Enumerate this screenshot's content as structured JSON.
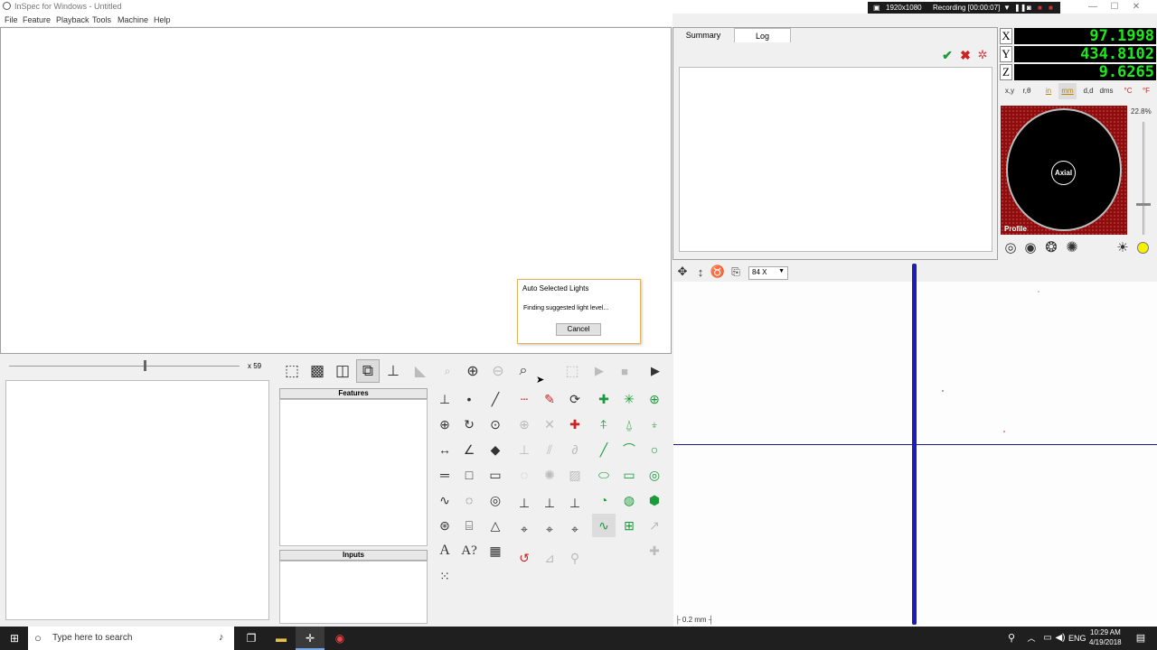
{
  "window": {
    "title": "InSpec for Windows - Untitled",
    "minimize": "—",
    "maximize": "☐",
    "close": "✕"
  },
  "recording": {
    "resolution": "1920x1080",
    "status": "Recording [00:00:07]"
  },
  "menu": [
    "File",
    "Feature",
    "Playback",
    "Tools",
    "Machine",
    "Help"
  ],
  "tabs": {
    "summary": "Summary",
    "log": "Log"
  },
  "dro": {
    "x_label": "X",
    "x_value": "97.1998",
    "y_label": "Y",
    "y_value": "434.8102",
    "z_label": "Z",
    "z_value": "9.6265",
    "mode_buttons": [
      "x,y",
      "r,θ",
      "in",
      "mm",
      "d,d",
      "dms",
      "°C",
      "°F"
    ]
  },
  "light": {
    "percent": "22.8%",
    "axial_label": "Axial",
    "profile_label": "Profile"
  },
  "slider": {
    "magnification": "x 59"
  },
  "panels": {
    "features": "Features",
    "inputs": "Inputs"
  },
  "camera": {
    "zoom": "84 X",
    "scale": "0.2 mm"
  },
  "dialog": {
    "title": "Auto Selected Lights",
    "message": "Finding suggested light level...",
    "cancel": "Cancel"
  },
  "taskbar": {
    "search_placeholder": "Type here to search",
    "language": "ENG",
    "time": "10:29 AM",
    "date": "4/19/2018"
  },
  "colors": {
    "dro_text": "#1ee81e",
    "light_ring": "#8b0d0d",
    "crosshair": "#1a1a8c",
    "edge_line": "#1d1db5"
  }
}
